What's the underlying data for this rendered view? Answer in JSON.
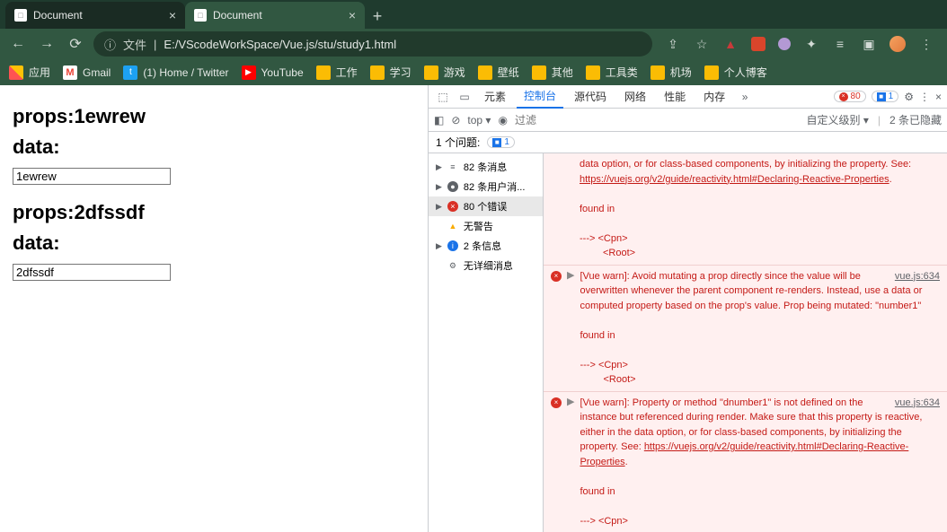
{
  "tabs": [
    {
      "title": "Document",
      "active": false
    },
    {
      "title": "Document",
      "active": true
    }
  ],
  "address": {
    "prefix": "文件",
    "url": "E:/VScodeWorkSpace/Vue.js/stu/study1.html"
  },
  "bookmarks": {
    "apps": "应用",
    "gmail": "Gmail",
    "twitter": "(1) Home / Twitter",
    "youtube": "YouTube",
    "folders": [
      "工作",
      "学习",
      "游戏",
      "壁纸",
      "其他",
      "工具类",
      "机场",
      "个人博客"
    ]
  },
  "page": {
    "h1": "props:1ewrew",
    "d1": "data:",
    "v1": "1ewrew",
    "h2": "props:2dfssdf",
    "d2": "data:",
    "v2": "2dfssdf"
  },
  "devtools": {
    "tabs": {
      "elements": "元素",
      "console": "控制台",
      "sources": "源代码",
      "network": "网络",
      "performance": "性能",
      "memory": "内存"
    },
    "errCount": "80",
    "infoCount": "1",
    "filter": {
      "top": "top",
      "placeholder": "过滤",
      "levels": "自定义级别",
      "hidden": "2 条已隐藏"
    },
    "issues": {
      "label": "1 个问题:",
      "count": "1"
    },
    "sidebar": {
      "messages": "82 条消息",
      "user": "82 条用户消...",
      "errors": "80 个错误",
      "warnings": "无警告",
      "info": "2 条信息",
      "verbose": "无详细消息"
    },
    "entries": [
      {
        "pretext": "data option, or for class-based components, by initializing the property. See: ",
        "link": "https://vuejs.org/v2/guide/reactivity.html#Declaring-Reactive-Properties",
        "found": "found in",
        "tree": "---> <Cpn>",
        "root": "<Root>"
      },
      {
        "src": "vue.js:634",
        "text": "[Vue warn]: Avoid mutating a prop directly since the value will be overwritten whenever the parent component re-renders. Instead, use a data or computed property based on the prop's value. Prop being mutated: \"number1\"",
        "found": "found in",
        "tree": "---> <Cpn>",
        "root": "<Root>"
      },
      {
        "src": "vue.js:634",
        "text": "[Vue warn]: Property or method \"dnumber1\" is not defined on the instance but referenced during render. Make sure that this property is reactive, either in the data option, or for class-based components, by initializing the property. See: ",
        "link": "https://vuejs.org/v2/guide/reactivity.html#Declaring-Reactive-Properties",
        "found": "found in",
        "tree": "---> <Cpn>"
      }
    ]
  }
}
